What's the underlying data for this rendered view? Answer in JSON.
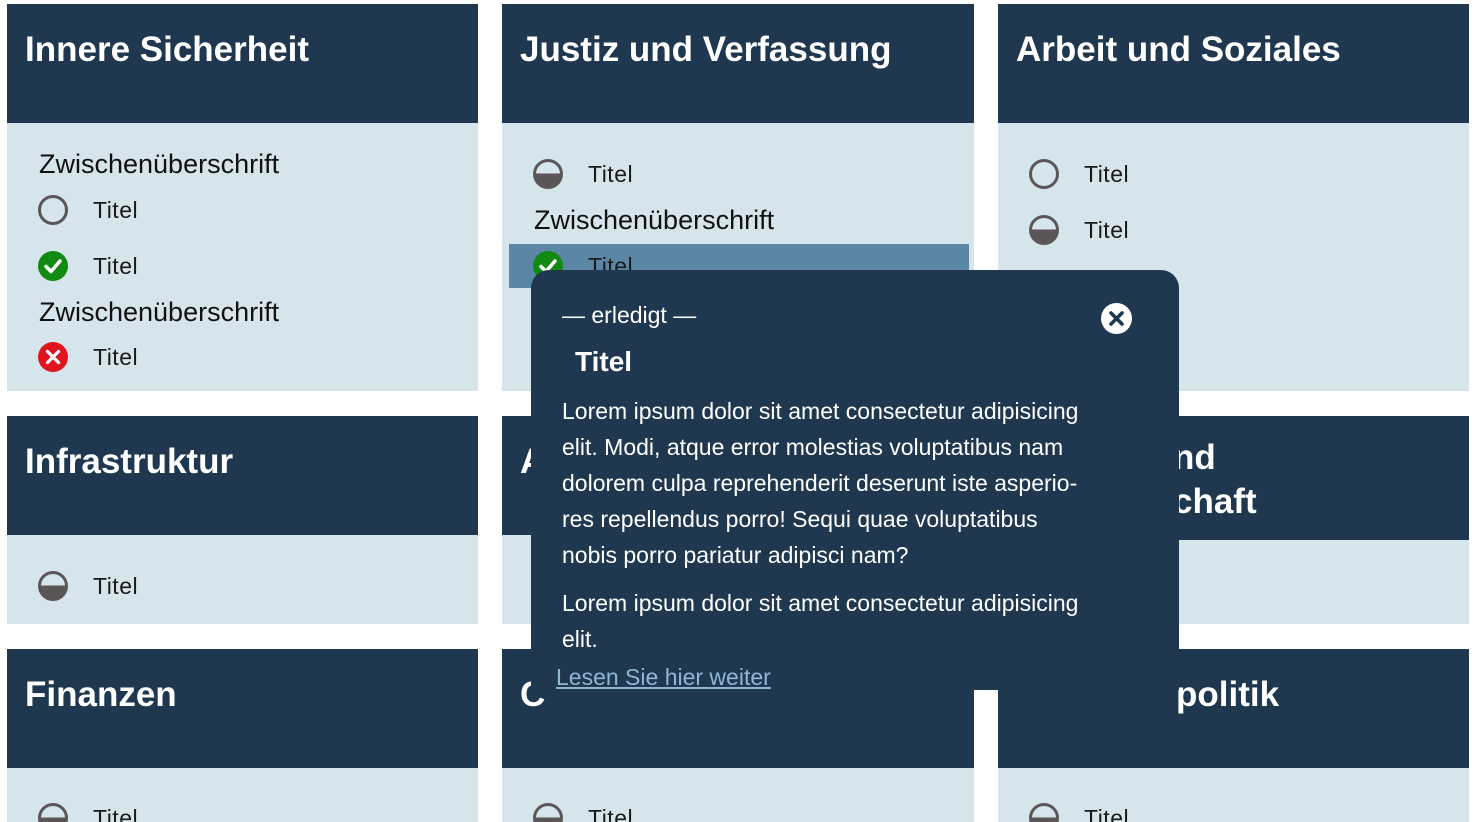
{
  "cards": {
    "innere_sicherheit": {
      "title": "Innere Sicherheit",
      "subheading_1": "Zwischenüberschrift",
      "item_1": "Titel",
      "item_2": "Titel",
      "subheading_2": "Zwischenüberschrift",
      "item_3": "Titel"
    },
    "justiz": {
      "title": "Justiz und Verfassung",
      "item_1": "Titel",
      "subheading_1": "Zwischenüberschrift",
      "item_2": "Titel"
    },
    "arbeit": {
      "title": "Arbeit und Soziales",
      "item_1": "Titel",
      "item_2": "Titel"
    },
    "infrastruktur": {
      "title": "Infrastruktur",
      "item_1": "Titel"
    },
    "middle_second": {
      "title_visible": "A"
    },
    "right_second": {
      "title_line1_visible": "nd",
      "title_line2_visible": "chaft"
    },
    "finanzen": {
      "title": "Finanzen",
      "item_1": "Titel"
    },
    "middle_third": {
      "title_visible": "C",
      "item_1": "Titel"
    },
    "right_third": {
      "title_visible": "politik",
      "item_1": "Titel"
    }
  },
  "popup": {
    "status_label": "— erledigt —",
    "title": "Titel",
    "paragraph_1_lines": [
      "Lorem ipsum dolor sit amet consectetur adipisicing",
      "elit. Modi, atque error molestias voluptatibus nam",
      "dolorem culpa reprehenderit deserunt iste asperio-",
      "res repellendus porro! Sequi quae voluptatibus",
      "nobis porro pariatur adipisci nam?"
    ],
    "paragraph_2_lines": [
      "Lorem ipsum dolor sit amet consectetur adipisicing",
      "elit."
    ],
    "read_more": "Lesen Sie hier weiter"
  },
  "colors": {
    "card_header": "#1f3850",
    "card_body": "#d6e4ec",
    "selected_row": "#5b87a6",
    "status_done": "#128a12",
    "status_fail": "#e0141e",
    "status_neutral": "#5b5656",
    "link": "#8fb6d4"
  }
}
